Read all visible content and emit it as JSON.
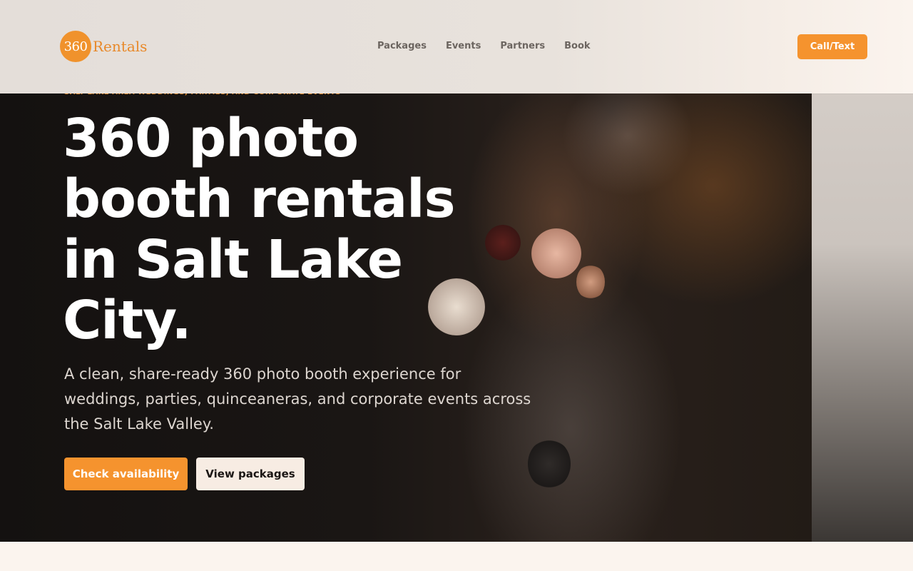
{
  "brand": {
    "logo_number": "360",
    "logo_word": "Rentals"
  },
  "nav": {
    "items": [
      "Packages",
      "Events",
      "Partners",
      "Book"
    ]
  },
  "header": {
    "cta_label": "Call/Text"
  },
  "hero": {
    "eyebrow": "SALT LAKE AREA WEDDINGS, PARTIES, AND CORPORATE EVENTS",
    "headline": "360 photo booth rentals in Salt Lake City.",
    "lede": "A clean, share-ready 360 photo booth experience for weddings, parties, quinceaneras, and corporate events across the Salt Lake Valley.",
    "primary_button": "Check availability",
    "secondary_button": "View packages"
  },
  "colors": {
    "accent": "#f5932e",
    "dark": "#141110",
    "cream": "#fbf4ee"
  }
}
